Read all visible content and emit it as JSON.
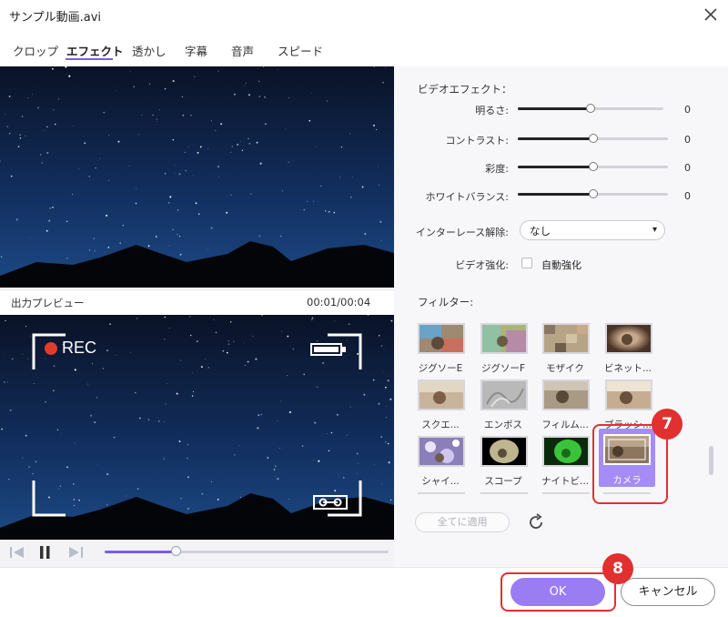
{
  "window": {
    "title": "サンプル動画.avi"
  },
  "tabs": [
    {
      "label": "クロップ"
    },
    {
      "label": "エフェクト"
    },
    {
      "label": "透かし"
    },
    {
      "label": "字幕"
    },
    {
      "label": "音声"
    },
    {
      "label": "スピード"
    }
  ],
  "preview": {
    "label": "出力プレビュー",
    "time": "00:01/00:04",
    "rec": "REC",
    "playback_progress": 0.25
  },
  "effects": {
    "section_title": "ビデオエフェクト：",
    "sliders": [
      {
        "label": "明るさ:",
        "value": "0",
        "level": 0.5
      },
      {
        "label": "コントラスト:",
        "value": "0",
        "level": 0.5
      },
      {
        "label": "彩度:",
        "value": "0",
        "level": 0.5
      },
      {
        "label": "ホワイトバランス:",
        "value": "0",
        "level": 0.5
      }
    ],
    "deinterlace": {
      "label": "インターレース解除:",
      "value": "なし"
    },
    "enhance": {
      "label": "ビデオ強化:",
      "checkbox_label": "自動強化"
    }
  },
  "filters": {
    "section_title": "フィルター:",
    "items": [
      {
        "label": "ジグソーE"
      },
      {
        "label": "ジグソーF"
      },
      {
        "label": "モザイク"
      },
      {
        "label": "ビネット..."
      },
      {
        "label": "スクエ..."
      },
      {
        "label": "エンボス"
      },
      {
        "label": "フィルム..."
      },
      {
        "label": "ブラッシ..."
      },
      {
        "label": "シャイ..."
      },
      {
        "label": "スコープ"
      },
      {
        "label": "ナイトビ..."
      },
      {
        "label": "カメラ"
      }
    ],
    "apply_all": "全てに適用"
  },
  "annotations": {
    "step7": "7",
    "step8": "8"
  },
  "footer": {
    "ok": "OK",
    "cancel": "キャンセル"
  },
  "colors": {
    "accent": "#9a7cf3",
    "annotation_red": "#e13030",
    "sky": "#0b1730"
  }
}
